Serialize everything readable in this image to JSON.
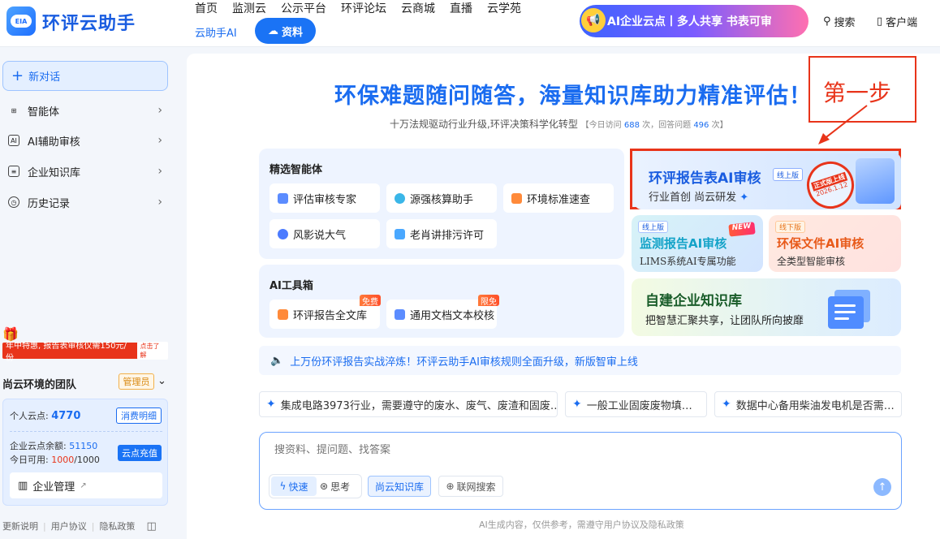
{
  "brand": {
    "logo_text": "EIA",
    "name": "环评云助手"
  },
  "nav": {
    "items": [
      "首页",
      "监测云",
      "公示平台",
      "环评论坛",
      "云商城",
      "直播",
      "云学苑"
    ],
    "ai_link": "云助手AI",
    "ziliao": "资料",
    "promo": "AI企业云点丨多人共享 书表可审",
    "search": "搜索",
    "client": "客户端"
  },
  "sidebar": {
    "new_chat": "新对话",
    "items": [
      {
        "label": "智能体"
      },
      {
        "label": "AI辅助审核"
      },
      {
        "label": "企业知识库"
      },
      {
        "label": "历史记录"
      }
    ],
    "promo": "年中特惠, 报告表审核仅需150元/份",
    "promo_btn": "点击了解",
    "team_name": "尚云环境的团队",
    "team_role": "管理员",
    "wallet": {
      "personal_label": "个人云点:",
      "personal_value": "4770",
      "detail_btn": "消费明细",
      "ent_balance_label": "企业云点余额:",
      "ent_balance_value": "51150",
      "today_label": "今日可用:",
      "today_used": "1000",
      "today_total": "/1000",
      "recharge_btn": "云点充值",
      "manage": "企业管理"
    },
    "footer": [
      "更新说明",
      "用户协议",
      "隐私政策"
    ]
  },
  "main": {
    "hero": "环保难题随问随答，海量知识库助力精准评估！",
    "subtitle": "十万法规驱动行业升级,环评决策科学化转型",
    "stat_prefix": "【今日访问",
    "visits": "688",
    "stat_mid": "次，回答问题",
    "answers": "496",
    "stat_suffix": "次】",
    "annotation": "第一步",
    "agents": {
      "title": "精选智能体",
      "items": [
        "评估审核专家",
        "源强核算助手",
        "环境标准速查",
        "风影说大气",
        "老肖讲排污许可"
      ]
    },
    "tools": {
      "title": "AI工具箱",
      "items": [
        {
          "label": "环评报告全文库",
          "tag": "免费"
        },
        {
          "label": "通用文档文本校核",
          "tag": "限免"
        }
      ]
    },
    "feature_main": {
      "title": "环评报告表AI审核",
      "badge": "线上版",
      "subtitle": "行业首创  尚云研发",
      "stamp_l1": "正式版上线",
      "stamp_l2": "2026.1.12"
    },
    "feature_monitor": {
      "tag": "线上版",
      "new_tag": "NEW",
      "title": "监测报告AI审核",
      "subtitle": "LIMS系统AI专属功能"
    },
    "feature_doc": {
      "tag": "线下版",
      "title": "环保文件AI审核",
      "subtitle": "全类型智能审核"
    },
    "feature_kb": {
      "title": "自建企业知识库",
      "subtitle": "把智慧汇聚共享，让团队所向披靡"
    },
    "notice": "上万份环评报告实战淬炼！环评云助手AI审核规则全面升级，新版智审上线",
    "suggestions": [
      "集成电路3973行业，需要遵守的废水、废气、废渣和固废…",
      "一般工业固废废物填…",
      "数据中心备用柴油发电机是否需…"
    ],
    "input": {
      "placeholder": "搜资料、提问题、找答案",
      "mode_fast": "快速",
      "mode_think": "思考",
      "kb_toggle": "尚云知识库",
      "web_toggle": "联网搜索"
    },
    "disclaimer": "AI生成内容，仅供参考，需遵守用户协议及隐私政策"
  },
  "colors": {
    "accent": "#1a6cf0",
    "annotation_red": "#e8341a"
  }
}
